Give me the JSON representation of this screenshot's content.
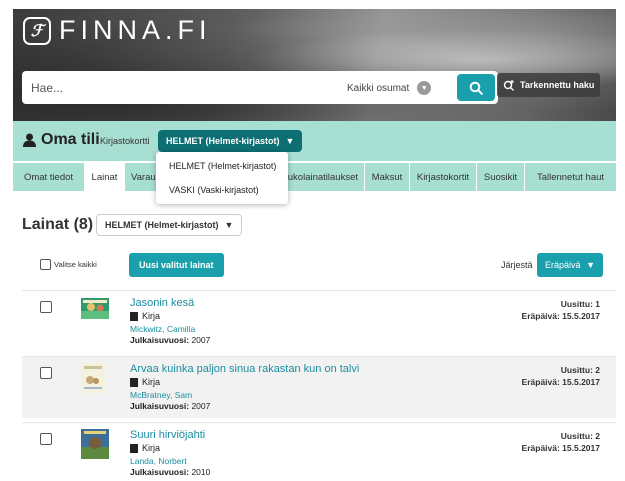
{
  "header": {
    "logo_text": "FINNA.FI",
    "search_placeholder": "Hae...",
    "search_scope": "Kaikki osumat",
    "advanced_search": "Tarkennettu haku"
  },
  "account": {
    "title": "Oma tili",
    "card_label": "Kirjastokortti",
    "card_selected": "HELMET (Helmet-kirjastot)",
    "card_options": [
      "HELMET (Helmet-kirjastot)",
      "VASKI (Vaski-kirjastot)"
    ]
  },
  "tabs": [
    {
      "label": "Omat tiedot"
    },
    {
      "label": "Lainat"
    },
    {
      "label": "Varaukset"
    },
    {
      "label": "Kaukolainatilaukset"
    },
    {
      "label": "Maksut"
    },
    {
      "label": "Kirjastokortit"
    },
    {
      "label": "Suosikit"
    },
    {
      "label": "Tallennetut haut"
    }
  ],
  "loans": {
    "title": "Lainat (8)",
    "library_select": "HELMET (Helmet-kirjastot)",
    "select_all": "Valitse kaikki",
    "renew_button": "Uusi valitut lainat",
    "sort_label": "Järjestä",
    "sort_value": "Eräpäivä",
    "items": [
      {
        "title": "Jasonin kesä",
        "format": "Kirja",
        "author": "Mickwitz, Camilla",
        "year_label": "Julkaisuvuosi:",
        "year": "2007",
        "renewals": "Uusittu: 1",
        "due": "Eräpäivä: 15.5.2017"
      },
      {
        "title": "Arvaa kuinka paljon sinua rakastan kun on talvi",
        "format": "Kirja",
        "author": "McBratney, Sam",
        "year_label": "Julkaisuvuosi:",
        "year": "2007",
        "renewals": "Uusittu: 2",
        "due": "Eräpäivä: 15.5.2017"
      },
      {
        "title": "Suuri hirviöjahti",
        "format": "Kirja",
        "author": "Landa, Norbert",
        "year_label": "Julkaisuvuosi:",
        "year": "2010",
        "renewals": "Uusittu: 2",
        "due": "Eräpäivä: 15.5.2017"
      }
    ]
  },
  "colors": {
    "accent": "#1aa0ad",
    "account_bar": "#a8dfd3",
    "dark_teal": "#0d6f74"
  },
  "icons": [
    "finna-logo-icon",
    "search-icon",
    "chevron-down-icon",
    "advanced-search-icon",
    "user-icon",
    "book-icon"
  ]
}
